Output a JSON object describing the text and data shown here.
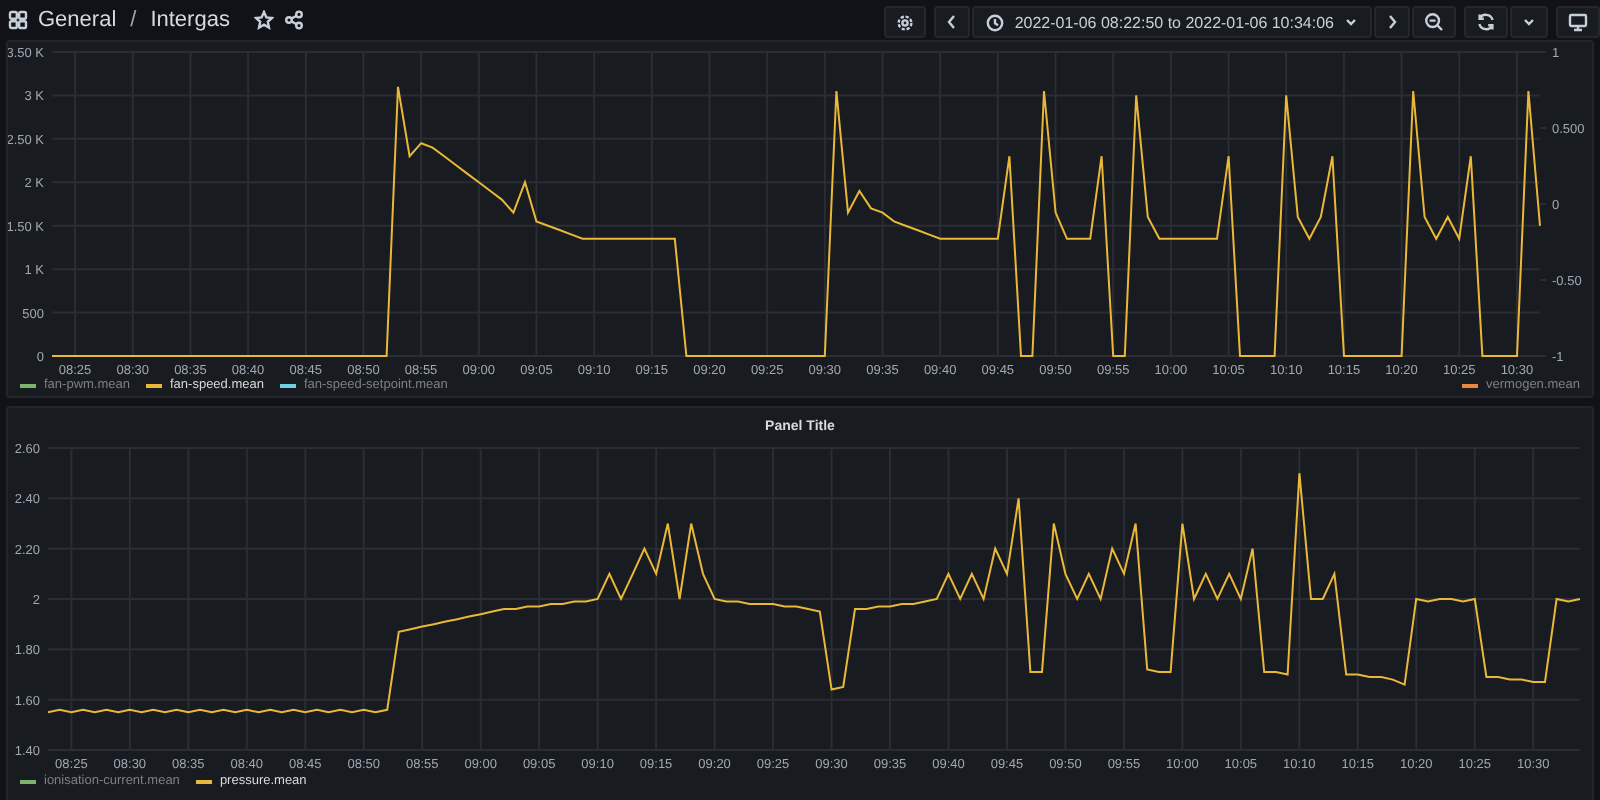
{
  "breadcrumb": {
    "folder": "General",
    "separator": "/",
    "dashboard": "Intergas"
  },
  "time_range": "2022-01-06 08:22:50 to 2022-01-06 10:34:06",
  "panels": [
    {
      "legend": [
        {
          "label": "fan-pwm.mean",
          "color": "#7eb26d",
          "hidden": true,
          "right_side": false
        },
        {
          "label": "fan-speed.mean",
          "color": "#eab839",
          "hidden": false,
          "right_side": false
        },
        {
          "label": "fan-speed-setpoint.mean",
          "color": "#6ed0e0",
          "hidden": true,
          "right_side": false
        },
        {
          "label": "vermogen.mean",
          "color": "#ef843c",
          "hidden": true,
          "right_side": true
        }
      ],
      "chart_data": {
        "type": "line",
        "grid": true,
        "ylim": [
          0,
          3500
        ],
        "categories": [
          null,
          null,
          "08:25",
          null,
          null,
          null,
          null,
          "08:30",
          null,
          null,
          null,
          null,
          "08:35",
          null,
          null,
          null,
          null,
          "08:40",
          null,
          null,
          null,
          null,
          "08:45",
          null,
          null,
          null,
          null,
          "08:50",
          null,
          null,
          null,
          null,
          "08:55",
          null,
          null,
          null,
          null,
          "09:00",
          null,
          null,
          null,
          null,
          "09:05",
          null,
          null,
          null,
          null,
          "09:10",
          null,
          null,
          null,
          null,
          "09:15",
          null,
          null,
          null,
          null,
          "09:20",
          null,
          null,
          null,
          null,
          "09:25",
          null,
          null,
          null,
          null,
          "09:30",
          null,
          null,
          null,
          null,
          "09:35",
          null,
          null,
          null,
          null,
          "09:40",
          null,
          null,
          null,
          null,
          "09:45",
          null,
          null,
          null,
          null,
          "09:50",
          null,
          null,
          null,
          null,
          "09:55",
          null,
          null,
          null,
          null,
          "10:00",
          null,
          null,
          null,
          null,
          "10:05",
          null,
          null,
          null,
          null,
          "10:10",
          null,
          null,
          null,
          null,
          "10:15",
          null,
          null,
          null,
          null,
          "10:20",
          null,
          null,
          null,
          null,
          "10:25",
          null,
          null,
          null,
          null,
          "10:30",
          null,
          null
        ],
        "yticks": [
          {
            "value": 0,
            "label": "0"
          },
          {
            "value": 500,
            "label": "500"
          },
          {
            "value": 1000,
            "label": "1 K"
          },
          {
            "value": 1500,
            "label": "1.50 K"
          },
          {
            "value": 2000,
            "label": "2 K"
          },
          {
            "value": 2500,
            "label": "2.50 K"
          },
          {
            "value": 3000,
            "label": "3 K"
          },
          {
            "value": 3500,
            "label": "3.50 K"
          }
        ],
        "y2lim": [
          -1,
          1
        ],
        "y2ticks": [
          {
            "value": 1,
            "label": "1"
          },
          {
            "value": 0.5,
            "label": "0.500"
          },
          {
            "value": 0,
            "label": "0"
          },
          {
            "value": -0.5,
            "label": "-0.50"
          },
          {
            "value": -1,
            "label": "-1"
          }
        ],
        "series": [
          {
            "color": "#eab839",
            "values": [
              0,
              0,
              0,
              0,
              0,
              0,
              0,
              0,
              0,
              0,
              0,
              0,
              0,
              0,
              0,
              0,
              0,
              0,
              0,
              0,
              0,
              0,
              0,
              0,
              0,
              0,
              0,
              0,
              0,
              0,
              3100,
              2300,
              2450,
              2400,
              2300,
              2200,
              2100,
              2000,
              1900,
              1800,
              1650,
              2000,
              1550,
              1500,
              1450,
              1400,
              1350,
              1350,
              1350,
              1350,
              1350,
              1350,
              1350,
              1350,
              1350,
              0,
              0,
              0,
              0,
              0,
              0,
              0,
              0,
              0,
              0,
              0,
              0,
              0,
              3050,
              1650,
              1900,
              1700,
              1650,
              1550,
              1500,
              1450,
              1400,
              1350,
              1350,
              1350,
              1350,
              1350,
              1350,
              2300,
              0,
              0,
              3050,
              1650,
              1350,
              1350,
              1350,
              2300,
              0,
              0,
              3000,
              1600,
              1350,
              1350,
              1350,
              1350,
              1350,
              1350,
              2300,
              0,
              0,
              0,
              0,
              3000,
              1600,
              1350,
              1600,
              2300,
              0,
              0,
              0,
              0,
              0,
              0,
              3050,
              1600,
              1350,
              1600,
              1350,
              2300,
              0,
              0,
              0,
              0,
              3050,
              1500
            ]
          }
        ]
      }
    },
    {
      "title": "Panel Title",
      "legend": [
        {
          "label": "ionisation-current.mean",
          "color": "#7eb26d",
          "hidden": true,
          "right_side": false
        },
        {
          "label": "pressure.mean",
          "color": "#eab839",
          "hidden": false,
          "right_side": false
        }
      ],
      "chart_data": {
        "type": "line",
        "grid": true,
        "ylim": [
          1.4,
          2.6
        ],
        "categories": [
          null,
          null,
          "08:25",
          null,
          null,
          null,
          null,
          "08:30",
          null,
          null,
          null,
          null,
          "08:35",
          null,
          null,
          null,
          null,
          "08:40",
          null,
          null,
          null,
          null,
          "08:45",
          null,
          null,
          null,
          null,
          "08:50",
          null,
          null,
          null,
          null,
          "08:55",
          null,
          null,
          null,
          null,
          "09:00",
          null,
          null,
          null,
          null,
          "09:05",
          null,
          null,
          null,
          null,
          "09:10",
          null,
          null,
          null,
          null,
          "09:15",
          null,
          null,
          null,
          null,
          "09:20",
          null,
          null,
          null,
          null,
          "09:25",
          null,
          null,
          null,
          null,
          "09:30",
          null,
          null,
          null,
          null,
          "09:35",
          null,
          null,
          null,
          null,
          "09:40",
          null,
          null,
          null,
          null,
          "09:45",
          null,
          null,
          null,
          null,
          "09:50",
          null,
          null,
          null,
          null,
          "09:55",
          null,
          null,
          null,
          null,
          "10:00",
          null,
          null,
          null,
          null,
          "10:05",
          null,
          null,
          null,
          null,
          "10:10",
          null,
          null,
          null,
          null,
          "10:15",
          null,
          null,
          null,
          null,
          "10:20",
          null,
          null,
          null,
          null,
          "10:25",
          null,
          null,
          null,
          null,
          "10:30",
          null,
          null,
          null,
          null
        ],
        "yticks": [
          {
            "value": 1.4,
            "label": "1.40"
          },
          {
            "value": 1.6,
            "label": "1.60"
          },
          {
            "value": 1.8,
            "label": "1.80"
          },
          {
            "value": 2.0,
            "label": "2"
          },
          {
            "value": 2.2,
            "label": "2.20"
          },
          {
            "value": 2.4,
            "label": "2.40"
          },
          {
            "value": 2.6,
            "label": "2.60"
          }
        ],
        "series": [
          {
            "color": "#eab839",
            "values": [
              1.55,
              1.56,
              1.55,
              1.56,
              1.55,
              1.56,
              1.55,
              1.56,
              1.55,
              1.56,
              1.55,
              1.56,
              1.55,
              1.56,
              1.55,
              1.56,
              1.55,
              1.56,
              1.55,
              1.56,
              1.55,
              1.56,
              1.55,
              1.56,
              1.55,
              1.56,
              1.55,
              1.56,
              1.55,
              1.56,
              1.87,
              1.88,
              1.89,
              1.9,
              1.91,
              1.92,
              1.93,
              1.94,
              1.95,
              1.96,
              1.96,
              1.97,
              1.97,
              1.98,
              1.98,
              1.99,
              1.99,
              2.0,
              2.1,
              2.0,
              2.1,
              2.2,
              2.1,
              2.3,
              2.0,
              2.3,
              2.1,
              2.0,
              1.99,
              1.99,
              1.98,
              1.98,
              1.98,
              1.97,
              1.97,
              1.96,
              1.95,
              1.64,
              1.65,
              1.96,
              1.96,
              1.97,
              1.97,
              1.98,
              1.98,
              1.99,
              2.0,
              2.1,
              2.0,
              2.1,
              2.0,
              2.2,
              2.1,
              2.4,
              1.71,
              1.71,
              2.3,
              2.1,
              2.0,
              2.1,
              2.0,
              2.2,
              2.1,
              2.3,
              1.72,
              1.71,
              1.71,
              2.3,
              2.0,
              2.1,
              2.0,
              2.1,
              2.0,
              2.2,
              1.71,
              1.71,
              1.7,
              2.5,
              2.0,
              2.0,
              2.1,
              1.7,
              1.7,
              1.69,
              1.69,
              1.68,
              1.66,
              2.0,
              1.99,
              2.0,
              2.0,
              1.99,
              2.0,
              1.69,
              1.69,
              1.68,
              1.68,
              1.67,
              1.67,
              2.0,
              1.99,
              2.0
            ]
          }
        ]
      }
    }
  ]
}
